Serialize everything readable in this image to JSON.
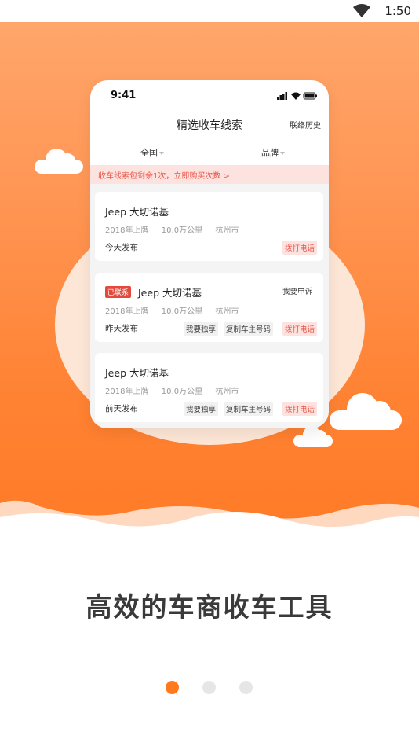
{
  "status_bar": {
    "time": "1:50"
  },
  "phone_mock": {
    "time": "9:41",
    "title": "精选收车线索",
    "history_link": "联络历史",
    "filters": [
      "全国",
      "品牌"
    ],
    "notice": "收车线索包剩余1次，立即购买次数 >",
    "cards": [
      {
        "title": "Jeep 大切诺基",
        "meta": "2018年上牌 ｜ 10.0万公里 ｜ 杭州市",
        "time": "今天发布",
        "call": "拨打电话"
      },
      {
        "badge": "已联系",
        "title": "Jeep 大切诺基",
        "complain": "我要申诉",
        "meta": "2018年上牌 ｜ 10.0万公里 ｜ 杭州市",
        "time": "昨天发布",
        "exclusive": "我要独享",
        "copy": "复制车主号码",
        "call": "拨打电话"
      },
      {
        "title": "Jeep 大切诺基",
        "meta": "2018年上牌 ｜ 10.0万公里 ｜ 杭州市",
        "time": "前天发布",
        "exclusive": "我要独享",
        "copy": "复制车主号码",
        "call": "拨打电话"
      }
    ]
  },
  "headline": "高效的车商收车工具",
  "pager": {
    "count": 3,
    "active": 1
  },
  "colors": {
    "accent": "#ff7a1f",
    "hero_top": "#ffa66b",
    "hero_bottom": "#ff7a26",
    "tag_red": "#e8574a"
  }
}
